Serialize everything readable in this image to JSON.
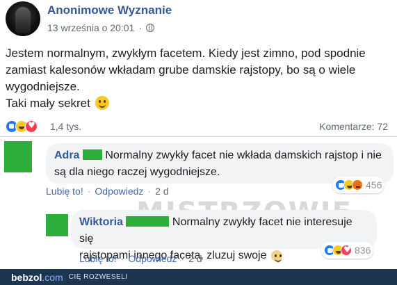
{
  "post": {
    "author": "Anonimowe Wyznanie",
    "date": "13 września o 20:01",
    "text_lines": [
      "Jestem normalnym, zwykłym facetem. Kiedy jest zimno, pod spodnie",
      "zamiast kalesonów wkładam grube damskie rajstopy, bo są o wiele",
      "wygodniejsze.",
      "Taki mały sekret"
    ],
    "reactions_count": "1,4 tys.",
    "comments_label": "Komentarze: 72"
  },
  "comments": [
    {
      "name": "Adra",
      "text_line1": "Normalny zwykły facet nie wkłada damskich rajstop i nie",
      "text_line2": "są dla niego raczej wygodniejsze.",
      "like_label": "Lubię to!",
      "reply_label": "Odpowiedz",
      "time": "2 d",
      "reactions": "456"
    },
    {
      "name": "Wiktoria",
      "text_line1": "Normalny zwykły facet nie interesuje się",
      "text_line2": "rajstopami innego faceta, zluzuj swoje",
      "like_label": "Lubię to!",
      "reply_label": "Odpowiedz",
      "time": "2 d",
      "reactions": "836"
    }
  ],
  "watermark": "MISTRZOWIE",
  "footer": {
    "brand_name": "bebzol",
    "brand_tld": ".com",
    "tagline": "CIĘ ROZWESELI"
  },
  "colors": {
    "link_blue": "#365899",
    "censor_green": "#2eaf3c",
    "footer_bg": "#1d3550"
  }
}
